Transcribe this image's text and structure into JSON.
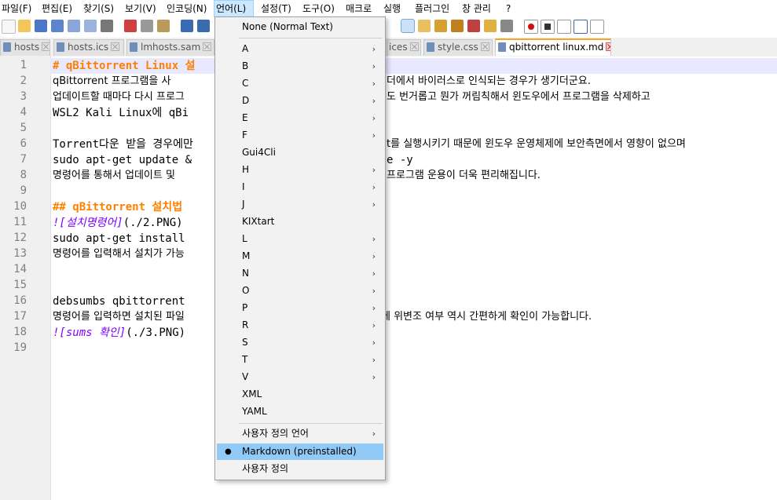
{
  "menubar": {
    "items": [
      "파일(F)",
      "편집(E)",
      "찾기(S)",
      "보기(V)",
      "인코딩(N)",
      "언어(L)",
      "설정(T)",
      "도구(O)",
      "매크로",
      "실행",
      "플러그인",
      "창 관리",
      "?"
    ]
  },
  "tabs": [
    {
      "label": "hosts"
    },
    {
      "label": "hosts.ics"
    },
    {
      "label": "lmhosts.sam"
    },
    {
      "label": "ices"
    },
    {
      "label": "style.css"
    },
    {
      "label": "qbittorrent linux.md"
    }
  ],
  "gutter": [
    "1",
    "2",
    "3",
    "4",
    "5",
    "6",
    "7",
    "8",
    "9",
    "10",
    "11",
    "12",
    "13",
    "14",
    "15",
    "16",
    "17",
    "18",
    "19"
  ],
  "editor": {
    "lines": [
      {
        "a": "# qBittorrent Linux 설",
        "b": ""
      },
      {
        "a": "qBittorrent 프로그램을 사",
        "b": "더에서 바이러스로 인식되는 경우가 생기더군요."
      },
      {
        "a": "업데이트할 때마다 다시 프로그",
        "b": "도 번거롭고 뭔가 꺼림칙해서 윈도우에서 프로그램을 삭제하고"
      },
      {
        "a": "WSL2 Kali Linux에 qBi",
        "b": ""
      },
      {
        "a": "",
        "b": ""
      },
      {
        "a": "Torrent다운 받을 경우에만",
        "b": "t를 실행시키기 때문에 윈도우 운영체제에 보안측면에서 영향이 없으며"
      },
      {
        "a": "sudo apt-get update &",
        "b": "e -y"
      },
      {
        "a": "명령어를 통해서 업데이트 및",
        "b": "프로그램 운용이 더욱 편리해집니다."
      },
      {
        "a": "",
        "b": ""
      },
      {
        "a": "## qBittorrent 설치법",
        "b": ""
      },
      {
        "a_img": "![설치명령어]",
        "a": "(./2.PNG)",
        "b": ""
      },
      {
        "a": "sudo apt-get install",
        "b": ""
      },
      {
        "a": "명령어를 입력해서 설치가 가능",
        "b": ""
      },
      {
        "a": "",
        "b": ""
      },
      {
        "a": "",
        "b": ""
      },
      {
        "a": "debsumbs qbittorrent",
        "b": ""
      },
      {
        "a": "명령어를 입력하면 설치된 파일",
        "b": "에 위변조 여부 역시 간편하게 확인이 가능합니다."
      },
      {
        "a_img": "![sums 확인]",
        "a": "(./3.PNG)",
        "b": ""
      },
      {
        "a": "",
        "b": ""
      }
    ]
  },
  "language_menu": {
    "items": [
      {
        "label": "None (Normal Text)",
        "submenu": false
      },
      {
        "label": "A",
        "submenu": true
      },
      {
        "label": "B",
        "submenu": true
      },
      {
        "label": "C",
        "submenu": true
      },
      {
        "label": "D",
        "submenu": true
      },
      {
        "label": "E",
        "submenu": true
      },
      {
        "label": "F",
        "submenu": true
      },
      {
        "label": "Gui4Cli",
        "submenu": false
      },
      {
        "label": "H",
        "submenu": true
      },
      {
        "label": "I",
        "submenu": true
      },
      {
        "label": "J",
        "submenu": true
      },
      {
        "label": "KIXtart",
        "submenu": false
      },
      {
        "label": "L",
        "submenu": true
      },
      {
        "label": "M",
        "submenu": true
      },
      {
        "label": "N",
        "submenu": true
      },
      {
        "label": "O",
        "submenu": true
      },
      {
        "label": "P",
        "submenu": true
      },
      {
        "label": "R",
        "submenu": true
      },
      {
        "label": "S",
        "submenu": true
      },
      {
        "label": "T",
        "submenu": true
      },
      {
        "label": "V",
        "submenu": true
      },
      {
        "label": "XML",
        "submenu": false
      },
      {
        "label": "YAML",
        "submenu": false
      },
      {
        "label": "사용자 정의 언어",
        "submenu": true
      },
      {
        "label": "Markdown (preinstalled)",
        "submenu": false,
        "checked": true
      },
      {
        "label": "사용자 정의",
        "submenu": false
      }
    ],
    "arrow_glyph": "›",
    "bullet_glyph": "●"
  },
  "colors": {
    "heading": "#ff8000",
    "image_link": "#8000ff",
    "highlight": "#91c9f7",
    "active_tab_accent": "#f5a623"
  }
}
